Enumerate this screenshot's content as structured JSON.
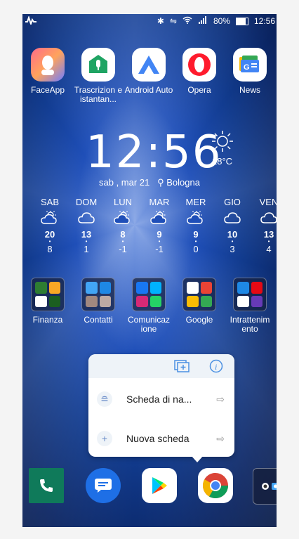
{
  "status": {
    "left_icon": "activity-icon",
    "battery": "80%",
    "time": "12:56"
  },
  "apps": [
    {
      "label": "FaceApp"
    },
    {
      "label": "Trascrizion e istantan..."
    },
    {
      "label": "Android Auto"
    },
    {
      "label": "Opera"
    },
    {
      "label": "News"
    }
  ],
  "clock": {
    "time": "12:56",
    "temp": "18°C",
    "date": "sab , mar 21",
    "location": "Bologna"
  },
  "forecast": [
    {
      "day": "SAB",
      "hi": "20",
      "lo": "8",
      "icon": "cloud-sun"
    },
    {
      "day": "DOM",
      "hi": "13",
      "lo": "1",
      "icon": "cloud"
    },
    {
      "day": "LUN",
      "hi": "8",
      "lo": "-1",
      "icon": "cloud-sun"
    },
    {
      "day": "MAR",
      "hi": "9",
      "lo": "-1",
      "icon": "cloud-sun"
    },
    {
      "day": "MER",
      "hi": "9",
      "lo": "0",
      "icon": "cloud-sun"
    },
    {
      "day": "GIO",
      "hi": "10",
      "lo": "3",
      "icon": "cloud"
    },
    {
      "day": "VEN",
      "hi": "13",
      "lo": "4",
      "icon": "cloud"
    }
  ],
  "folders": [
    {
      "label": "Finanza"
    },
    {
      "label": "Contatti"
    },
    {
      "label": "Comunicaz ione"
    },
    {
      "label": "Google"
    },
    {
      "label": "Intrattenim ento"
    }
  ],
  "popup": {
    "items": [
      {
        "label": "Scheda di na...",
        "icon": "incognito-icon"
      },
      {
        "label": "Nuova scheda",
        "icon": "plus-icon"
      }
    ]
  },
  "colors": {
    "accent": "#4a90e2",
    "wallpaper": "#113a8c"
  }
}
